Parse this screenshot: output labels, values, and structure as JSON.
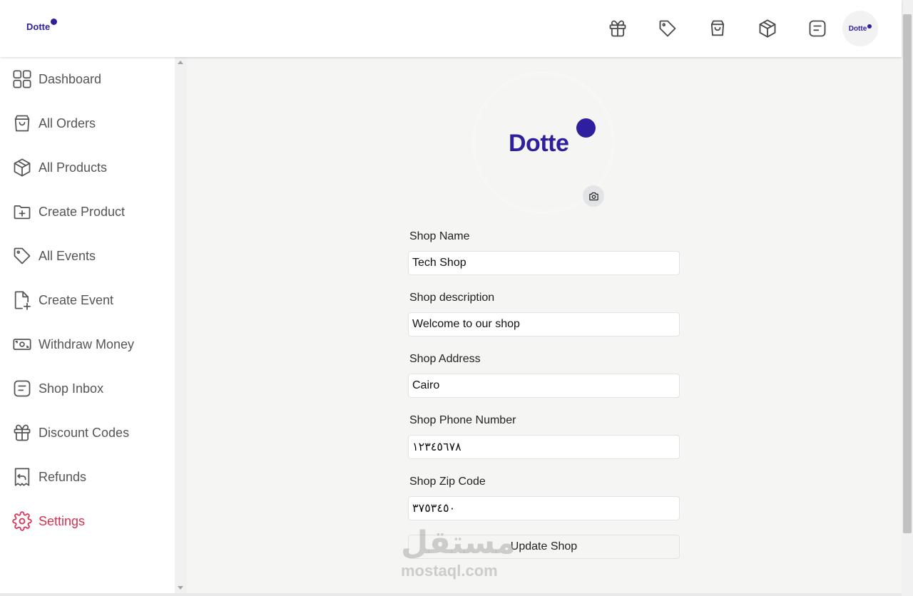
{
  "header": {
    "logo_text": "Dotte",
    "avatar_text": "Dotte",
    "icons": [
      "gift-icon",
      "tag-icon",
      "shopping-bag-icon",
      "package-icon",
      "message-square-icon"
    ]
  },
  "sidebar": {
    "items": [
      {
        "label": "Dashboard",
        "icon": "dashboard-grid-icon"
      },
      {
        "label": "All Orders",
        "icon": "shopping-bag-icon"
      },
      {
        "label": "All Products",
        "icon": "package-icon"
      },
      {
        "label": "Create Product",
        "icon": "folder-plus-icon"
      },
      {
        "label": "All Events",
        "icon": "tag-icon"
      },
      {
        "label": "Create Event",
        "icon": "file-plus-icon"
      },
      {
        "label": "Withdraw Money",
        "icon": "banknote-icon"
      },
      {
        "label": "Shop Inbox",
        "icon": "message-square-icon"
      },
      {
        "label": "Discount Codes",
        "icon": "gift-icon"
      },
      {
        "label": "Refunds",
        "icon": "receipt-refund-icon"
      },
      {
        "label": "Settings",
        "icon": "gear-icon",
        "active": true
      }
    ]
  },
  "profile": {
    "logo_text": "Dotte"
  },
  "form": {
    "shop_name": {
      "label": "Shop Name",
      "value": "Tech Shop"
    },
    "shop_description": {
      "label": "Shop description",
      "value": "Welcome to our shop"
    },
    "shop_address": {
      "label": "Shop Address",
      "value": "Cairo"
    },
    "shop_phone": {
      "label": "Shop Phone Number",
      "value": "١٢٣٤٥٦٧٨"
    },
    "shop_zip": {
      "label": "Shop Zip Code",
      "value": "٣٧٥٣٤٥٠"
    },
    "submit_label": "Update Shop"
  },
  "watermark": {
    "arabic": "مستقل",
    "latin": "mostaql.com"
  },
  "colors": {
    "brand": "#2d1f9e",
    "active": "#dc2f4f"
  }
}
